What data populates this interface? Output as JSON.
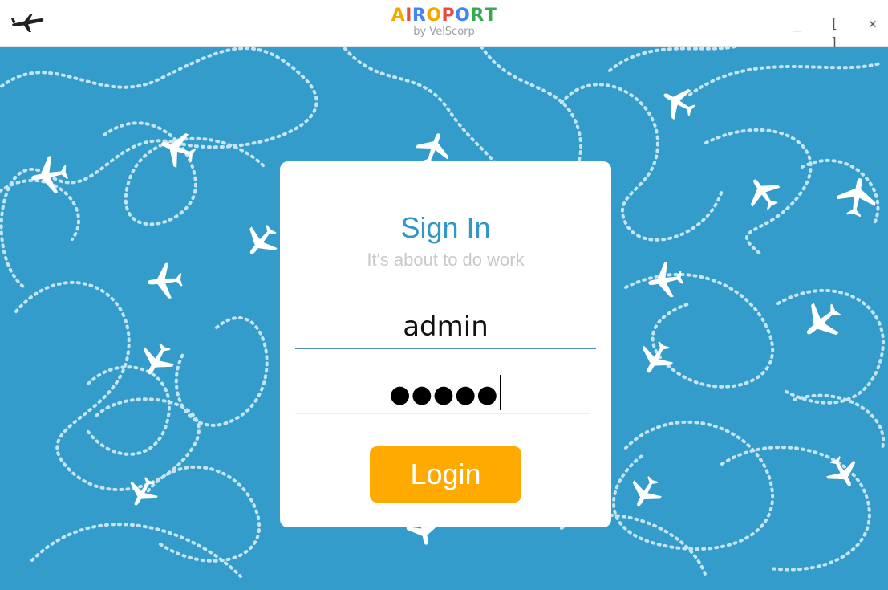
{
  "window": {
    "brand_letters": [
      {
        "char": "A",
        "color": "#f3a800"
      },
      {
        "char": "I",
        "color": "#e74c3c"
      },
      {
        "char": "R",
        "color": "#4285f4"
      },
      {
        "char": "O",
        "color": "#f3a800"
      },
      {
        "char": "P",
        "color": "#e74c3c"
      },
      {
        "char": "O",
        "color": "#4285f4"
      },
      {
        "char": "R",
        "color": "#34a853"
      },
      {
        "char": "T",
        "color": "#34a853"
      }
    ],
    "byline": "by VelScorp",
    "controls": {
      "minimize": "_",
      "maximize": "[ ]",
      "close": "✕"
    },
    "logo_icon": "airplane-icon"
  },
  "background": {
    "color": "#349ccb",
    "pattern": "white airplanes with dotted flight paths"
  },
  "login": {
    "title": "Sign In",
    "subtitle": "It's about to do work",
    "username_value": "admin",
    "password_masked": "●●●●●",
    "button_label": "Login",
    "accent_color": "#3198c5",
    "button_color": "#ffaa00"
  }
}
